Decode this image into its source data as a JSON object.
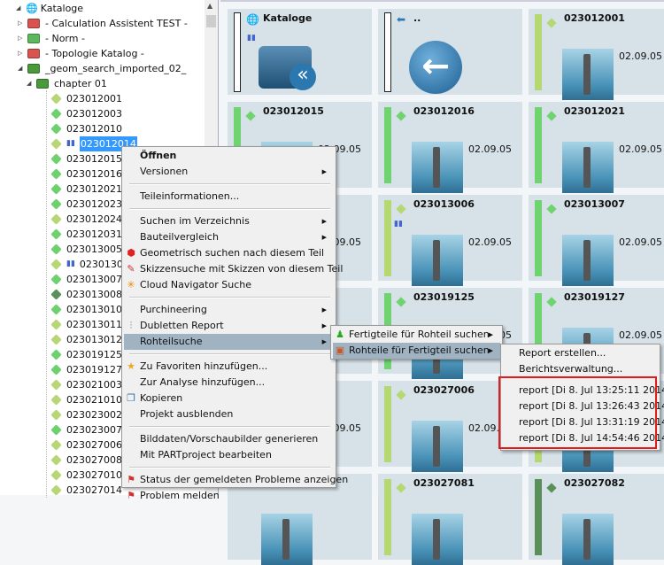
{
  "tree": {
    "root": "Kataloge",
    "catalogs": [
      "- Calculation Assistent TEST -",
      "- Norm -",
      "- Topologie Katalog -",
      "_geom_search_imported_02_"
    ],
    "chapter": "chapter 01",
    "parts": [
      {
        "id": "023012001",
        "color": "#b9d676"
      },
      {
        "id": "023012003",
        "color": "#6fd06f"
      },
      {
        "id": "023012010",
        "color": "#6fd06f"
      },
      {
        "id": "023012014",
        "color": "#b9d676",
        "selected": true,
        "chart": true
      },
      {
        "id": "023012015",
        "color": "#6fd06f"
      },
      {
        "id": "023012016",
        "color": "#6fd06f"
      },
      {
        "id": "023012021",
        "color": "#6fd06f"
      },
      {
        "id": "0230120231",
        "color": "#6fd06f"
      },
      {
        "id": "023012024",
        "color": "#b9d676"
      },
      {
        "id": "023012031",
        "color": "#6fd06f"
      },
      {
        "id": "023013005",
        "color": "#6fd06f"
      },
      {
        "id": "023013006",
        "color": "#b9d676",
        "chart": true
      },
      {
        "id": "023013007",
        "color": "#6fd06f"
      },
      {
        "id": "023013008",
        "color": "#5a8f5a"
      },
      {
        "id": "023013010",
        "color": "#6fd06f"
      },
      {
        "id": "023013011",
        "color": "#b9d676"
      },
      {
        "id": "023013012",
        "color": "#b9d676"
      },
      {
        "id": "023019125",
        "color": "#6fd06f"
      },
      {
        "id": "023019127",
        "color": "#6fd06f"
      },
      {
        "id": "023021003",
        "color": "#b9d676"
      },
      {
        "id": "023021010",
        "color": "#b9d676"
      },
      {
        "id": "023023002",
        "color": "#b9d676"
      },
      {
        "id": "023023007",
        "color": "#6fd06f"
      },
      {
        "id": "023027006",
        "color": "#b9d676"
      },
      {
        "id": "023027008",
        "color": "#b9d676"
      },
      {
        "id": "023027010",
        "color": "#b9d676"
      },
      {
        "id": "023027014",
        "color": "#b9d676"
      }
    ]
  },
  "cards": [
    {
      "title": "Kataloge",
      "kind": "catalog"
    },
    {
      "title": "..",
      "kind": "back"
    },
    {
      "title": "023012001",
      "date": "02.09.05",
      "bar": "#b5d873"
    },
    {
      "title": "023012015",
      "date": "02.09.05",
      "bar": "#6fd36f"
    },
    {
      "title": "023012016",
      "date": "02.09.05",
      "bar": "#6fd36f"
    },
    {
      "title": "023012021",
      "date": "02.09.05",
      "bar": "#6fd36f"
    },
    {
      "kind": "hidden",
      "date": "02.09.05"
    },
    {
      "title": "023013006",
      "date": "02.09.05",
      "bar": "#b5d873"
    },
    {
      "title": "023013007",
      "date": "02.09.05",
      "bar": "#6fd36f"
    },
    {
      "kind": "hidden",
      "date": "02.09.05"
    },
    {
      "title": "023019125",
      "date": "02.09.05",
      "bar": "#6fd36f"
    },
    {
      "title": "023019127",
      "date": "02.09.05",
      "bar": "#6fd36f"
    },
    {
      "kind": "hidden",
      "date": "02.09.05"
    },
    {
      "title": "023027006",
      "date": "02.09.05",
      "bar": "#b5d873"
    },
    {
      "kind": "hidden",
      "bar": "#b5d873"
    },
    {
      "kind": "hidden"
    },
    {
      "title": "023027081",
      "bar": "#b5d873"
    },
    {
      "title": "023027082",
      "bar": "#5a8f5a"
    }
  ],
  "context_menu": [
    {
      "label": "Öffnen",
      "bold": true
    },
    {
      "label": "Versionen",
      "sub": true
    },
    {
      "sep": true
    },
    {
      "label": "Teileinformationen..."
    },
    {
      "sep": true
    },
    {
      "label": "Suchen im Verzeichnis",
      "sub": true
    },
    {
      "label": "Bauteilvergleich",
      "sub": true
    },
    {
      "label": "Geometrisch suchen nach diesem Teil",
      "icon": "geometric-search-icon",
      "glyph": "⬢",
      "color": "#d22"
    },
    {
      "label": "Skizzensuche mit Skizzen von diesem Teil",
      "icon": "sketch-search-icon",
      "glyph": "✎",
      "color": "#c33"
    },
    {
      "label": "Cloud Navigator Suche",
      "icon": "cloud-navigator-icon",
      "glyph": "✳",
      "color": "#e80"
    },
    {
      "sep": true
    },
    {
      "label": "Purchineering",
      "sub": true
    },
    {
      "label": "Dubletten Report",
      "sub": true,
      "icon": "duplicates-icon",
      "glyph": "⫶",
      "color": "#58a"
    },
    {
      "label": "Rohteilsuche",
      "sub": true,
      "highlighted": true
    },
    {
      "sep": true
    },
    {
      "label": "Zu Favoriten hinzufügen...",
      "icon": "star-icon",
      "glyph": "★",
      "color": "#e9a826"
    },
    {
      "label": "Zur Analyse hinzufügen..."
    },
    {
      "label": "Kopieren",
      "icon": "copy-icon",
      "glyph": "❐",
      "color": "#37a"
    },
    {
      "label": "Projekt ausblenden"
    },
    {
      "sep": true
    },
    {
      "label": "Bilddaten/Vorschaubilder generieren"
    },
    {
      "label": "Mit PARTproject bearbeiten"
    },
    {
      "sep": true
    },
    {
      "label": "Status der gemeldeten Probleme anzeigen",
      "icon": "problem-status-icon",
      "glyph": "⚑",
      "color": "#c33"
    },
    {
      "label": "Problem melden",
      "icon": "report-problem-icon",
      "glyph": "⚑",
      "color": "#c33"
    }
  ],
  "submenu_rohteil": [
    {
      "label": "Fertigteile für Rohteil suchen",
      "icon": "finished-part-icon",
      "glyph": "♟",
      "color": "#2a2"
    },
    {
      "label": "Rohteile für Fertigteil suchen",
      "icon": "raw-part-icon",
      "glyph": "▣",
      "color": "#c52",
      "highlighted": true
    }
  ],
  "submenu_reports": {
    "actions": [
      "Report erstellen...",
      "Berichtsverwaltung..."
    ],
    "reports": [
      "report [Di 8. Jul 13:25:11 2014]",
      "report [Di 8. Jul 13:26:43 2014]",
      "report [Di 8. Jul 13:31:19 2014]",
      "report [Di 8. Jul 14:54:46 2014]"
    ]
  }
}
